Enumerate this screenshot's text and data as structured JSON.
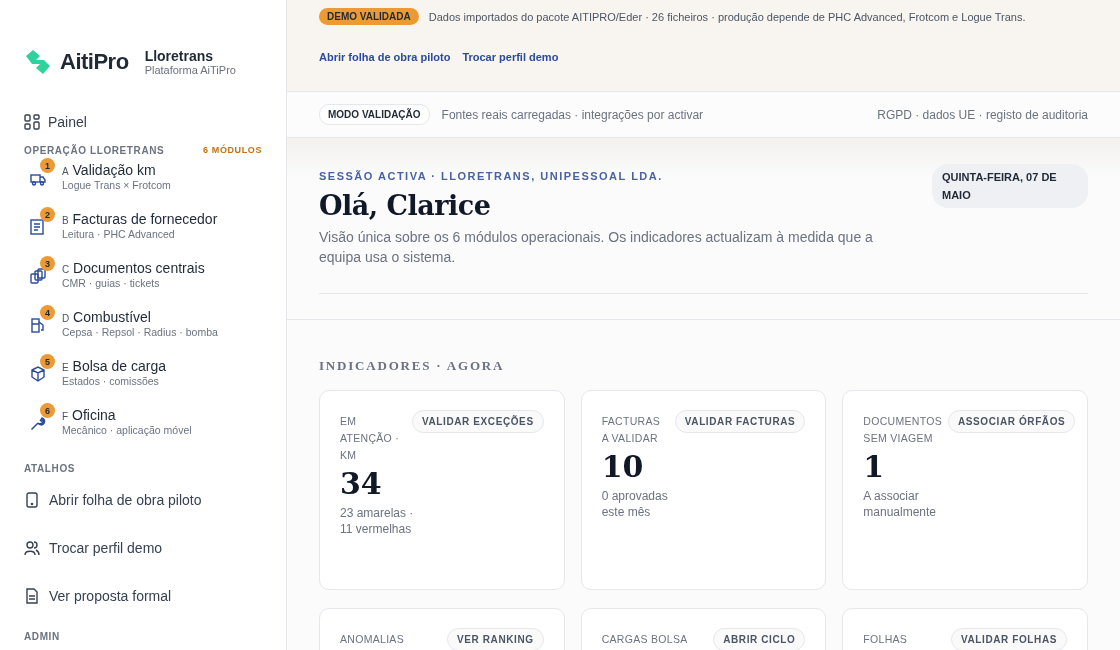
{
  "brand": {
    "logo_text": "AitiPro",
    "title": "Lloretrans",
    "subtitle": "Plataforma AiTiPro"
  },
  "sidebar": {
    "dashboard": {
      "label": "Painel"
    },
    "modules": {
      "title": "OPERAÇÃO LLORETRANS",
      "count": "6 MÓDULOS",
      "items": [
        {
          "kind": "truck",
          "badge": "1",
          "letter": "A",
          "title": "Validação km",
          "subtitle": "Logue Trans × Frotcom"
        },
        {
          "kind": "invoice",
          "badge": "2",
          "letter": "B",
          "title": "Facturas de fornecedor",
          "subtitle": "Leitura · PHC Advanced"
        },
        {
          "kind": "documents",
          "badge": "3",
          "letter": "C",
          "title": "Documentos centrais",
          "subtitle": "CMR · guias · tickets"
        },
        {
          "kind": "fuel",
          "badge": "4",
          "letter": "D",
          "title": "Combustível",
          "subtitle": "Cepsa · Repsol · Radius · bomba"
        },
        {
          "kind": "package",
          "badge": "5",
          "letter": "E",
          "title": "Bolsa de carga",
          "subtitle": "Estados · comissões"
        },
        {
          "kind": "wrench",
          "badge": "6",
          "letter": "F",
          "title": "Oficina",
          "subtitle": "Mecânico · aplicação móvel"
        }
      ]
    },
    "shortcuts": {
      "title": "ATALHOS",
      "items": [
        {
          "kind": "phone",
          "label": "Abrir folha de obra piloto"
        },
        {
          "kind": "users",
          "label": "Trocar perfil demo"
        },
        {
          "kind": "document",
          "label": "Ver proposta formal"
        }
      ]
    },
    "admin": {
      "title": "ADMIN"
    }
  },
  "banner": {
    "badge": "DEMO VALIDADA",
    "text": "Dados importados do pacote AITIPRO/Eder · 26 ficheiros · produção depende de PHC Advanced, Frotcom e Logue Trans.",
    "links": [
      "Abrir folha de obra piloto",
      "Trocar perfil demo"
    ]
  },
  "status_bar": {
    "mode": "MODO VALIDAÇÃO",
    "text": "Fontes reais carregadas · integrações por activar",
    "right": "RGPD · dados UE · registo de auditoria"
  },
  "hero": {
    "eyebrow": "SESSÃO ACTIVA · LLORETRANS, UNIPESSOAL LDA.",
    "greeting": "Olá, Clarice",
    "description": "Visão única sobre os 6 módulos operacionais. Os indicadores actualizam à medida que a equipa usa o sistema.",
    "date": "QUINTA-FEIRA, 07 DE MAIO"
  },
  "indicators": {
    "title": "INDICADORES · AGORA",
    "cards": [
      {
        "label": "EM ATENÇÃO · KM",
        "action": "VALIDAR EXCEÇÕES",
        "value": "34",
        "note": "23 amarelas · 11 vermelhas"
      },
      {
        "label": "FACTURAS A VALIDAR",
        "action": "VALIDAR FACTURAS",
        "value": "10",
        "note": "0 aprovadas este mês"
      },
      {
        "label": "DOCUMENTOS SEM VIAGEM",
        "action": "ASSOCIAR ÓRFÃOS",
        "value": "1",
        "note": "A associar manualmente"
      },
      {
        "label": "ANOMALIAS",
        "action": "VER RANKING"
      },
      {
        "label": "CARGAS BOLSA",
        "action": "ABRIR CICLO"
      },
      {
        "label": "FOLHAS",
        "action": "VALIDAR FOLHAS"
      }
    ]
  }
}
